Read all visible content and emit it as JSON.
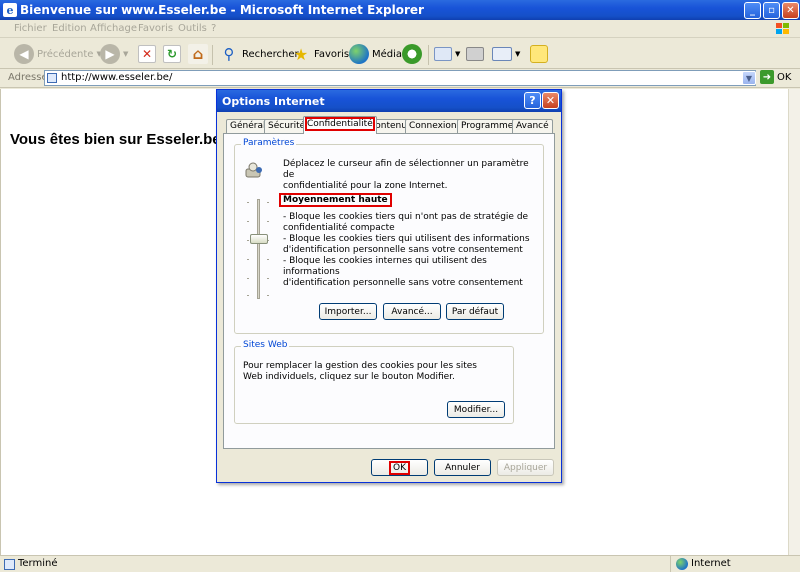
{
  "window": {
    "title": "Bienvenue sur www.Esseler.be - Microsoft Internet Explorer"
  },
  "menu": [
    "Fichier",
    "Edition",
    "Affichage",
    "Favoris",
    "Outils",
    "?"
  ],
  "toolbar": {
    "back_label": "Précédente",
    "search_label": "Rechercher",
    "favorites_label": "Favoris",
    "media_label": "Média"
  },
  "address": {
    "label": "Adresse",
    "url": "http://www.esseler.be/",
    "go_label": "OK"
  },
  "page": {
    "heading": "Vous êtes bien sur Esseler.be."
  },
  "status": {
    "text": "Terminé",
    "zone": "Internet"
  },
  "dialog": {
    "title": "Options Internet",
    "tabs": [
      "Général",
      "Sécurité",
      "Confidentialité",
      "Contenu",
      "Connexions",
      "Programmes",
      "Avancé"
    ],
    "active_tab": "Confidentialité",
    "settings_group": {
      "legend": "Paramètres",
      "description_line1": "Déplacez le curseur afin de sélectionner un paramètre de",
      "description_line2": "confidentialité pour la zone Internet.",
      "level_title": "Moyennement haute",
      "level_lines": [
        "- Bloque les cookies tiers qui n'ont pas de stratégie de",
        "confidentialité compacte",
        "- Bloque les cookies tiers qui utilisent des informations",
        "d'identification personnelle sans votre consentement",
        "- Bloque les cookies internes qui utilisent des informations",
        "d'identification personnelle sans votre consentement"
      ],
      "slider_level": 3,
      "slider_levels_total": 6,
      "import_button": "Importer...",
      "advanced_button": "Avancé...",
      "default_button": "Par défaut"
    },
    "sites_group": {
      "legend": "Sites Web",
      "description_line1": "Pour remplacer la gestion des cookies pour les sites",
      "description_line2": "Web individuels, cliquez sur le bouton Modifier.",
      "edit_button": "Modifier..."
    },
    "ok_button": "OK",
    "cancel_button": "Annuler",
    "apply_button": "Appliquer"
  }
}
